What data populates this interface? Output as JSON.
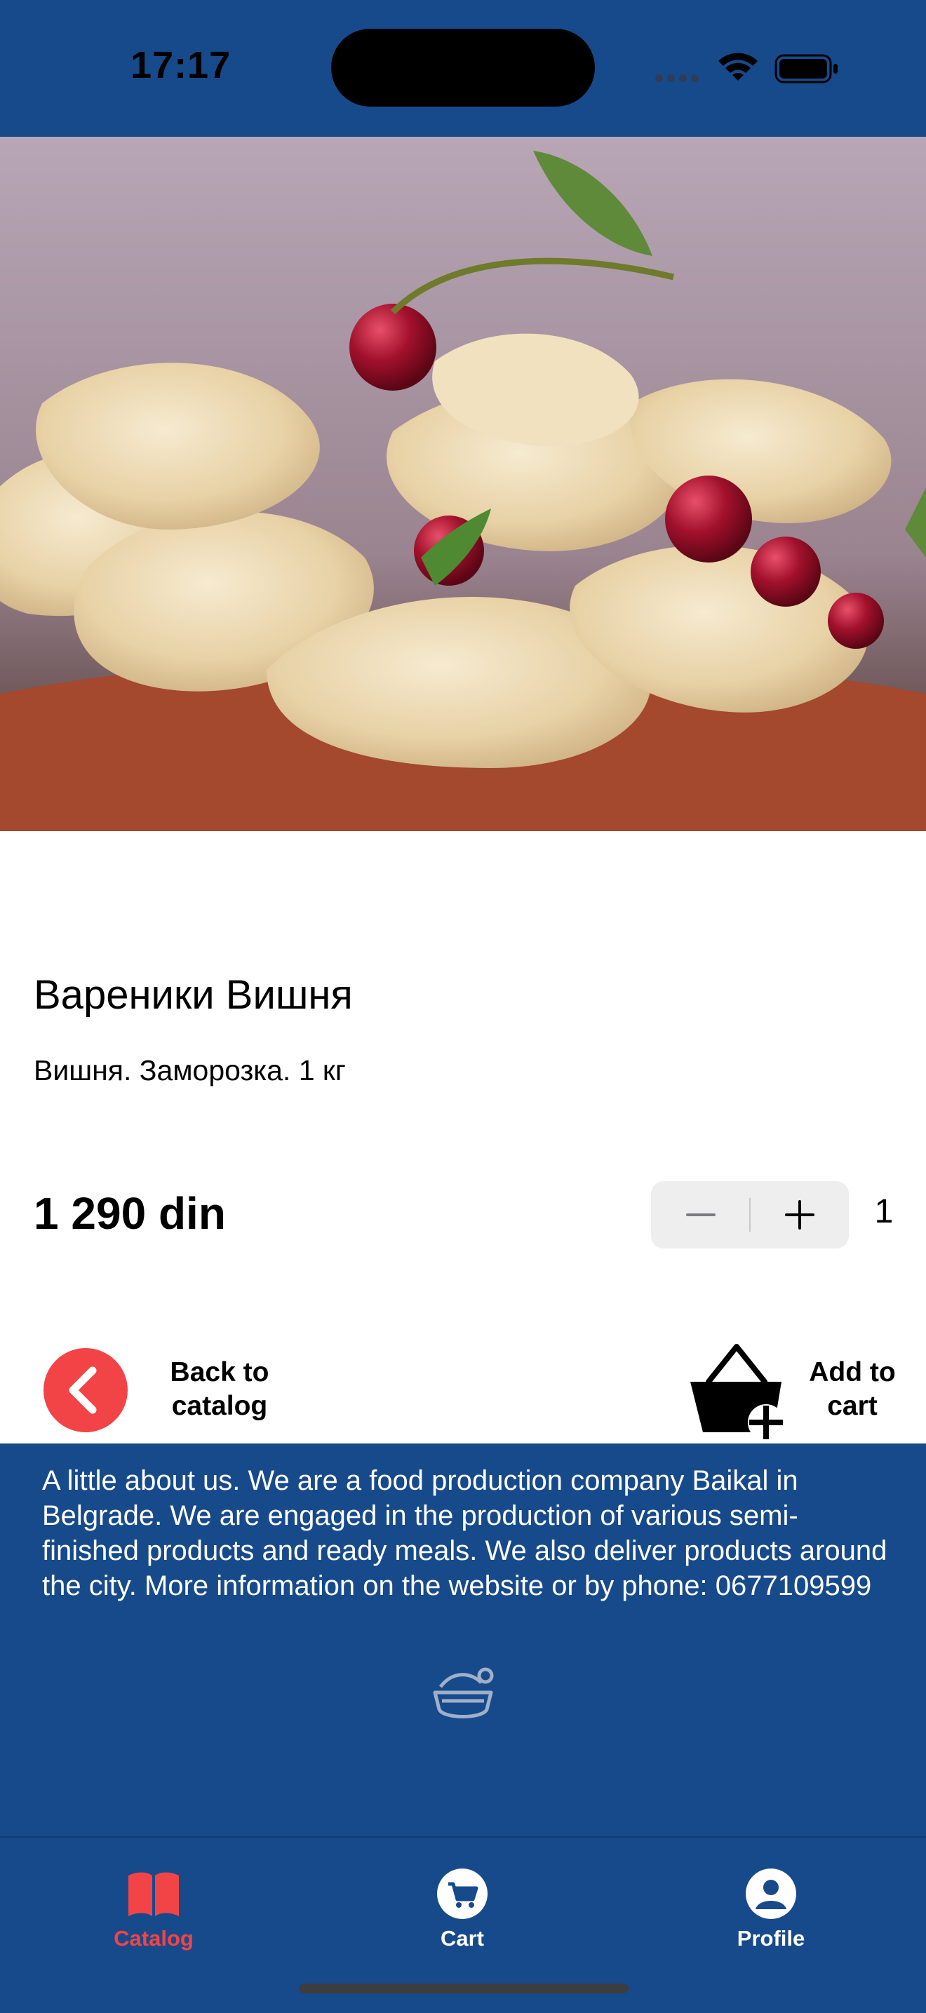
{
  "status_bar": {
    "time": "17:17",
    "icons": [
      "cellular-signal-icon",
      "wifi-icon",
      "battery-icon"
    ]
  },
  "product": {
    "image": "dumplings-with-cherries-photo",
    "title": "Вареники Вишня",
    "description": "Вишня. Заморозка. 1 кг",
    "price": "1 290 din",
    "quantity": "1"
  },
  "actions": {
    "back_label": "Back to catalog",
    "add_to_cart_label": "Add to cart"
  },
  "footer": {
    "about": "A little about us. We are a food production company Baikal in Belgrade. We are engaged in the production of various semi-finished products and ready meals. We also deliver products around the city. More information on the website or by phone: 0677109599"
  },
  "tabs": [
    {
      "label": "Catalog",
      "icon": "book-icon",
      "active": true
    },
    {
      "label": "Cart",
      "icon": "cart-icon",
      "active": false
    },
    {
      "label": "Profile",
      "icon": "person-icon",
      "active": false
    }
  ],
  "colors": {
    "brand_blue": "#174a8b",
    "accent_red": "#f24447",
    "tab_active": "#f24447",
    "tab_inactive": "#ffffff",
    "stepper_bg": "#eeeeef"
  }
}
